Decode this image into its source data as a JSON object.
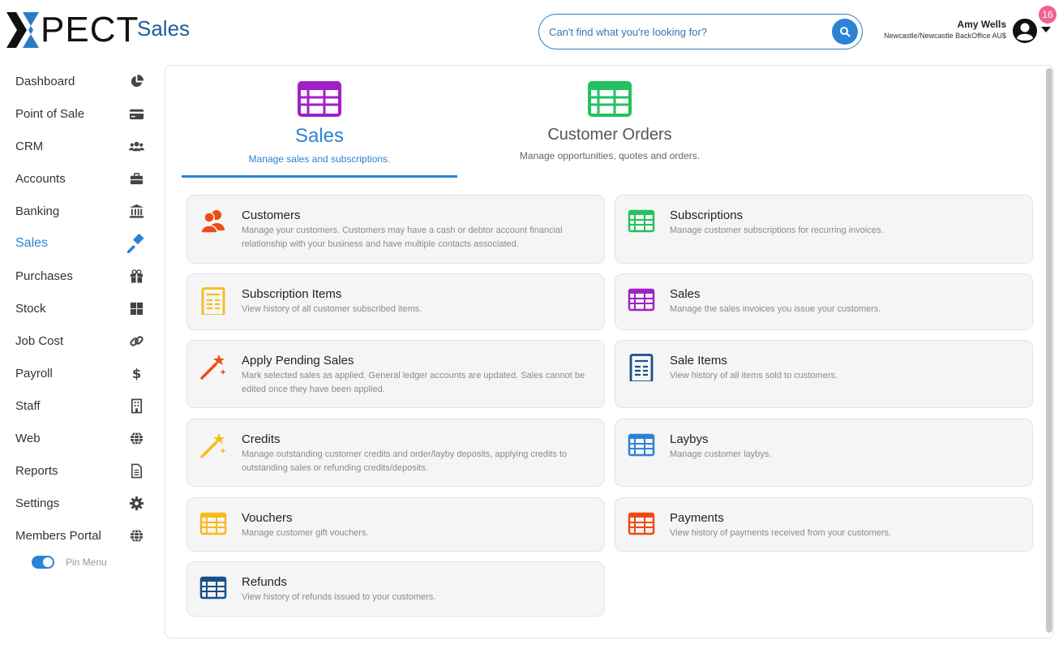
{
  "header": {
    "logo_text": "PECT",
    "app_title": "Sales",
    "search_placeholder": "Can't find what you're looking for?",
    "user_name": "Amy Wells",
    "user_location": "Newcastle/Newcastle BackOffice AU$",
    "notification_count": "16"
  },
  "sidebar": {
    "items": [
      {
        "label": "Dashboard",
        "icon": "pie-chart-icon"
      },
      {
        "label": "Point of Sale",
        "icon": "credit-card-icon"
      },
      {
        "label": "CRM",
        "icon": "users-icon"
      },
      {
        "label": "Accounts",
        "icon": "briefcase-icon"
      },
      {
        "label": "Banking",
        "icon": "bank-icon"
      },
      {
        "label": "Sales",
        "icon": "gavel-icon",
        "active": true
      },
      {
        "label": "Purchases",
        "icon": "gift-icon"
      },
      {
        "label": "Stock",
        "icon": "grid-icon"
      },
      {
        "label": "Job Cost",
        "icon": "link-icon"
      },
      {
        "label": "Payroll",
        "icon": "dollar-icon"
      },
      {
        "label": "Staff",
        "icon": "building-icon"
      },
      {
        "label": "Web",
        "icon": "globe-icon"
      },
      {
        "label": "Reports",
        "icon": "file-icon"
      },
      {
        "label": "Settings",
        "icon": "gear-icon"
      },
      {
        "label": "Members Portal",
        "icon": "globe-icon"
      }
    ],
    "pin_label": "Pin Menu"
  },
  "tabs": [
    {
      "label": "Sales",
      "subtitle": "Manage sales and subscriptions.",
      "active": true
    },
    {
      "label": "Customer Orders",
      "subtitle": "Manage opportunities, quotes and orders.",
      "active": false
    }
  ],
  "cards": [
    {
      "title": "Customers",
      "desc": "Manage your customers. Customers may have a cash or debtor account financial relationship with your business and have multiple contacts associated.",
      "icon": "users-icon",
      "color": "#ef4b14"
    },
    {
      "title": "Subscriptions",
      "desc": "Manage customer subscriptions for recurring invoices.",
      "icon": "table-icon",
      "color": "#22c25f"
    },
    {
      "title": "Subscription Items",
      "desc": "View history of all customer subscribed items.",
      "icon": "document-icon",
      "color": "#f5bc1c"
    },
    {
      "title": "Sales",
      "desc": "Manage the sales invoices you issue your customers.",
      "icon": "table-icon",
      "color": "#a020c8"
    },
    {
      "title": "Apply Pending Sales",
      "desc": "Mark selected sales as applied. General ledger accounts are updated. Sales cannot be edited once they have been applied.",
      "icon": "magic-wand-icon",
      "color": "#ef4b14"
    },
    {
      "title": "Sale Items",
      "desc": "View history of all items sold to customers.",
      "icon": "document-icon",
      "color": "#174f8c"
    },
    {
      "title": "Credits",
      "desc": "Manage outstanding customer credits and order/layby deposits, applying credits to outstanding sales or refunding credits/deposits.",
      "icon": "magic-wand-icon",
      "color": "#f5bc1c"
    },
    {
      "title": "Laybys",
      "desc": "Manage customer laybys.",
      "icon": "table-icon",
      "color": "#2b83d6"
    },
    {
      "title": "Vouchers",
      "desc": "Manage customer gift vouchers.",
      "icon": "table-icon",
      "color": "#f5bc1c"
    },
    {
      "title": "Payments",
      "desc": "View history of payments received from your customers.",
      "icon": "table-icon",
      "color": "#ef4b14"
    },
    {
      "title": "Refunds",
      "desc": "View history of refunds issued to your customers.",
      "icon": "table-icon",
      "color": "#174f8c"
    }
  ]
}
